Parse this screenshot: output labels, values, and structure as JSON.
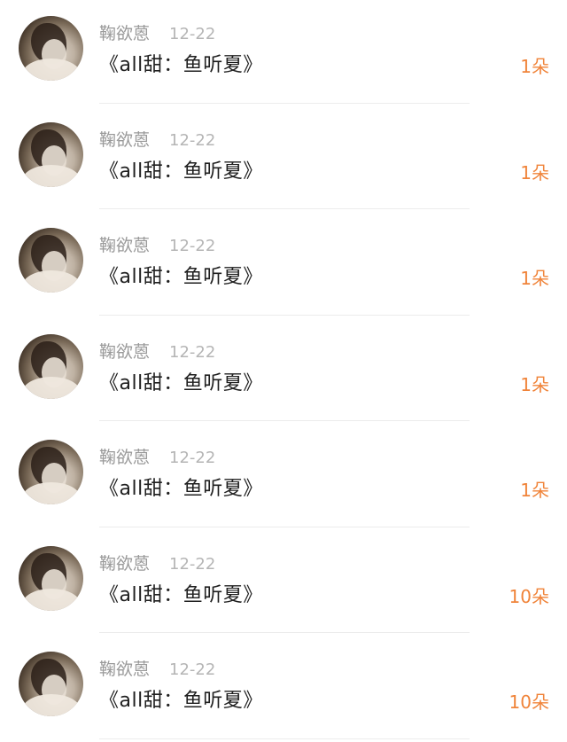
{
  "items": [
    {
      "name": "鞠欲蒽",
      "date": "12-22",
      "title": "《all甜：鱼听夏》",
      "count": "1朵"
    },
    {
      "name": "鞠欲蒽",
      "date": "12-22",
      "title": "《all甜：鱼听夏》",
      "count": "1朵"
    },
    {
      "name": "鞠欲蒽",
      "date": "12-22",
      "title": "《all甜：鱼听夏》",
      "count": "1朵"
    },
    {
      "name": "鞠欲蒽",
      "date": "12-22",
      "title": "《all甜：鱼听夏》",
      "count": "1朵"
    },
    {
      "name": "鞠欲蒽",
      "date": "12-22",
      "title": "《all甜：鱼听夏》",
      "count": "1朵"
    },
    {
      "name": "鞠欲蒽",
      "date": "12-22",
      "title": "《all甜：鱼听夏》",
      "count": "10朵"
    },
    {
      "name": "鞠欲蒽",
      "date": "12-22",
      "title": "《all甜：鱼听夏》",
      "count": "10朵"
    }
  ],
  "colors": {
    "name": "#9a9a9a",
    "date": "#b5b5b5",
    "title": "#1f1f1f",
    "count": "#f0843a",
    "divider": "#ececec"
  }
}
